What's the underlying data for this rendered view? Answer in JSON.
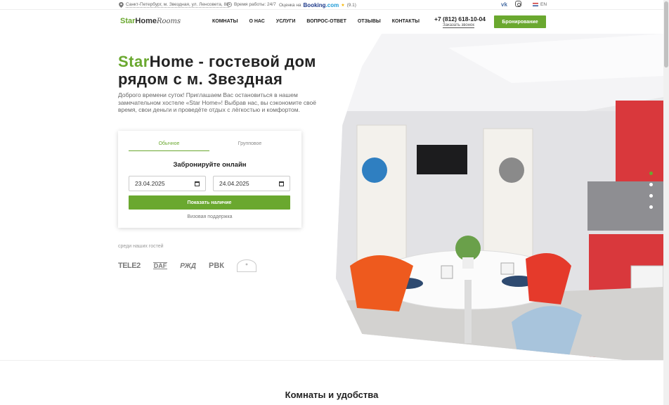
{
  "topbar": {
    "address": "Санкт-Петербург, м. Звездная, ул. Ленсовета, 88",
    "hours": "Время работы: 24/7",
    "rating_prefix": "Оценка на",
    "booking_brand": "Booking",
    "booking_dotcom": ".com",
    "rating_value": "(9.1)",
    "lang": "EN"
  },
  "header": {
    "logo_star": "Star",
    "logo_home": "Home",
    "logo_rooms": "Rooms",
    "nav": [
      "КОМНАТЫ",
      "О НАС",
      "УСЛУГИ",
      "ВОПРОС-ОТВЕТ",
      "ОТЗЫВЫ",
      "КОНТАКТЫ"
    ],
    "phone": "+7 (812) 618-10-04",
    "callback": "Заказать звонок",
    "book_button": "Бронирование"
  },
  "hero": {
    "title_accent": "Star",
    "title_rest": "Home - гостевой дом",
    "title_line2": "рядом с м. Звездная",
    "subtitle": "Доброго времени суток! Приглашаем Вас остановиться в нашем замечательном хостеле «Star Home»! Выбрав нас, вы сэкономите своё время, свои деньги и проведёте отдых с лёгкостью и комфортом."
  },
  "booking": {
    "tabs": [
      "Обычное",
      "Групповое"
    ],
    "heading": "Забронируйте онлайн",
    "date_from": "23.04.2025",
    "date_to": "24.04.2025",
    "show_button": "Показать наличие",
    "visa_link": "Визовая поддержка"
  },
  "guests": {
    "label": "среди наших гостей",
    "partners": [
      "TELE2",
      "DAF",
      "РЖД",
      "РВК"
    ]
  },
  "rooms_section": {
    "title": "Комнаты и удобства"
  }
}
